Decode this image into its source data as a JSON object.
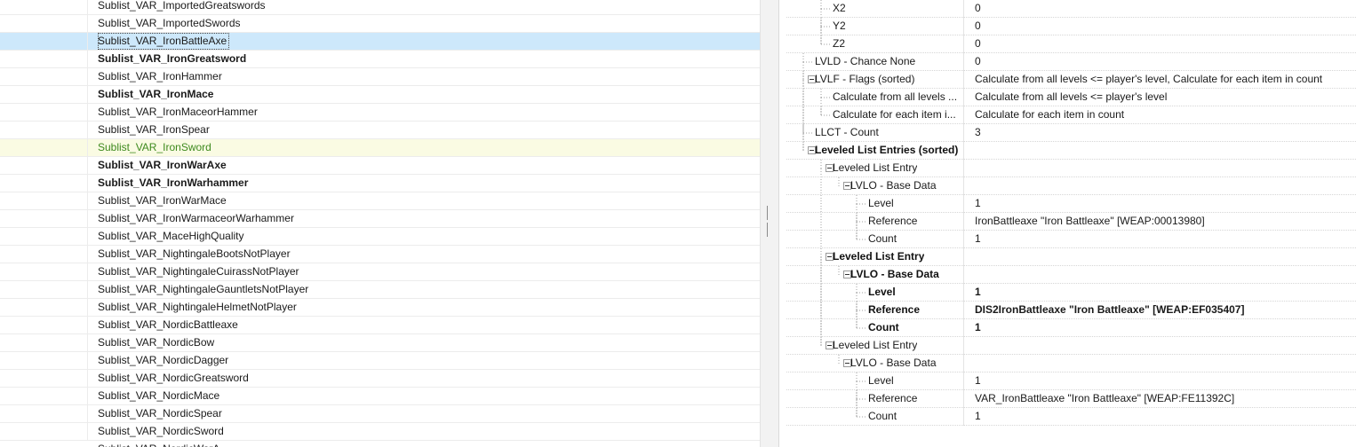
{
  "left_list": {
    "rows": [
      {
        "text": "Sublist_VAR_ImportedGreatswords",
        "style": "normal"
      },
      {
        "text": "Sublist_VAR_ImportedSwords",
        "style": "normal"
      },
      {
        "text": "Sublist_VAR_IronBattleAxe",
        "style": "selected"
      },
      {
        "text": "Sublist_VAR_IronGreatsword",
        "style": "bold"
      },
      {
        "text": "Sublist_VAR_IronHammer",
        "style": "normal"
      },
      {
        "text": "Sublist_VAR_IronMace",
        "style": "bold"
      },
      {
        "text": "Sublist_VAR_IronMaceorHammer",
        "style": "normal"
      },
      {
        "text": "Sublist_VAR_IronSpear",
        "style": "normal"
      },
      {
        "text": "Sublist_VAR_IronSword",
        "style": "green"
      },
      {
        "text": "Sublist_VAR_IronWarAxe",
        "style": "bold"
      },
      {
        "text": "Sublist_VAR_IronWarhammer",
        "style": "bold"
      },
      {
        "text": "Sublist_VAR_IronWarMace",
        "style": "normal"
      },
      {
        "text": "Sublist_VAR_IronWarmaceorWarhammer",
        "style": "normal"
      },
      {
        "text": "Sublist_VAR_MaceHighQuality",
        "style": "normal"
      },
      {
        "text": "Sublist_VAR_NightingaleBootsNotPlayer",
        "style": "normal"
      },
      {
        "text": "Sublist_VAR_NightingaleCuirassNotPlayer",
        "style": "normal"
      },
      {
        "text": "Sublist_VAR_NightingaleGauntletsNotPlayer",
        "style": "normal"
      },
      {
        "text": "Sublist_VAR_NightingaleHelmetNotPlayer",
        "style": "normal"
      },
      {
        "text": "Sublist_VAR_NordicBattleaxe",
        "style": "normal"
      },
      {
        "text": "Sublist_VAR_NordicBow",
        "style": "normal"
      },
      {
        "text": "Sublist_VAR_NordicDagger",
        "style": "normal"
      },
      {
        "text": "Sublist_VAR_NordicGreatsword",
        "style": "normal"
      },
      {
        "text": "Sublist_VAR_NordicMace",
        "style": "normal"
      },
      {
        "text": "Sublist_VAR_NordicSpear",
        "style": "normal"
      },
      {
        "text": "Sublist_VAR_NordicSword",
        "style": "normal"
      }
    ],
    "cutoff_row": "Sublist_VAR_NordicWarA..."
  },
  "colors": {
    "selected_bg": "#cde8fb",
    "green_text": "#3e8a1e",
    "green_bg": "#fafbe3"
  },
  "record_tree": {
    "rows": [
      {
        "name": "X2",
        "value": "0",
        "depth": 2,
        "bold": false,
        "expander": false
      },
      {
        "name": "Y2",
        "value": "0",
        "depth": 2,
        "bold": false,
        "expander": false
      },
      {
        "name": "Z2",
        "value": "0",
        "depth": 2,
        "bold": false,
        "expander": false
      },
      {
        "name": "LVLD - Chance None",
        "value": "0",
        "depth": 1,
        "bold": false,
        "expander": false
      },
      {
        "name": "LVLF - Flags (sorted)",
        "value": "Calculate from all levels <= player's level, Calculate for each item in count",
        "depth": 1,
        "bold": false,
        "expander": true
      },
      {
        "name": "Calculate from all levels ...",
        "value": "Calculate from all levels <= player's level",
        "depth": 2,
        "bold": false,
        "expander": false
      },
      {
        "name": "Calculate for each item i...",
        "value": "Calculate for each item in count",
        "depth": 2,
        "bold": false,
        "expander": false
      },
      {
        "name": "LLCT - Count",
        "value": "3",
        "depth": 1,
        "bold": false,
        "expander": false
      },
      {
        "name": "Leveled List Entries (sorted)",
        "value": "",
        "depth": 1,
        "bold": true,
        "expander": true
      },
      {
        "name": "Leveled List Entry",
        "value": "",
        "depth": 2,
        "bold": false,
        "expander": true
      },
      {
        "name": "LVLO - Base Data",
        "value": "",
        "depth": 3,
        "bold": false,
        "expander": true
      },
      {
        "name": "Level",
        "value": "1",
        "depth": 4,
        "bold": false,
        "expander": false
      },
      {
        "name": "Reference",
        "value": "IronBattleaxe \"Iron Battleaxe\" [WEAP:00013980]",
        "depth": 4,
        "bold": false,
        "expander": false
      },
      {
        "name": "Count",
        "value": "1",
        "depth": 4,
        "bold": false,
        "expander": false
      },
      {
        "name": "Leveled List Entry",
        "value": "",
        "depth": 2,
        "bold": true,
        "expander": true
      },
      {
        "name": "LVLO - Base Data",
        "value": "",
        "depth": 3,
        "bold": true,
        "expander": true
      },
      {
        "name": "Level",
        "value": "1",
        "depth": 4,
        "bold": true,
        "expander": false
      },
      {
        "name": "Reference",
        "value": "DIS2IronBattleaxe \"Iron Battleaxe\" [WEAP:EF035407]",
        "depth": 4,
        "bold": true,
        "expander": false
      },
      {
        "name": "Count",
        "value": "1",
        "depth": 4,
        "bold": true,
        "expander": false
      },
      {
        "name": "Leveled List Entry",
        "value": "",
        "depth": 2,
        "bold": false,
        "expander": true
      },
      {
        "name": "LVLO - Base Data",
        "value": "",
        "depth": 3,
        "bold": false,
        "expander": true
      },
      {
        "name": "Level",
        "value": "1",
        "depth": 4,
        "bold": false,
        "expander": false
      },
      {
        "name": "Reference",
        "value": "VAR_IronBattleaxe \"Iron Battleaxe\" [WEAP:FE11392C]",
        "depth": 4,
        "bold": false,
        "expander": false
      },
      {
        "name": "Count",
        "value": "1",
        "depth": 4,
        "bold": false,
        "expander": false
      }
    ]
  }
}
